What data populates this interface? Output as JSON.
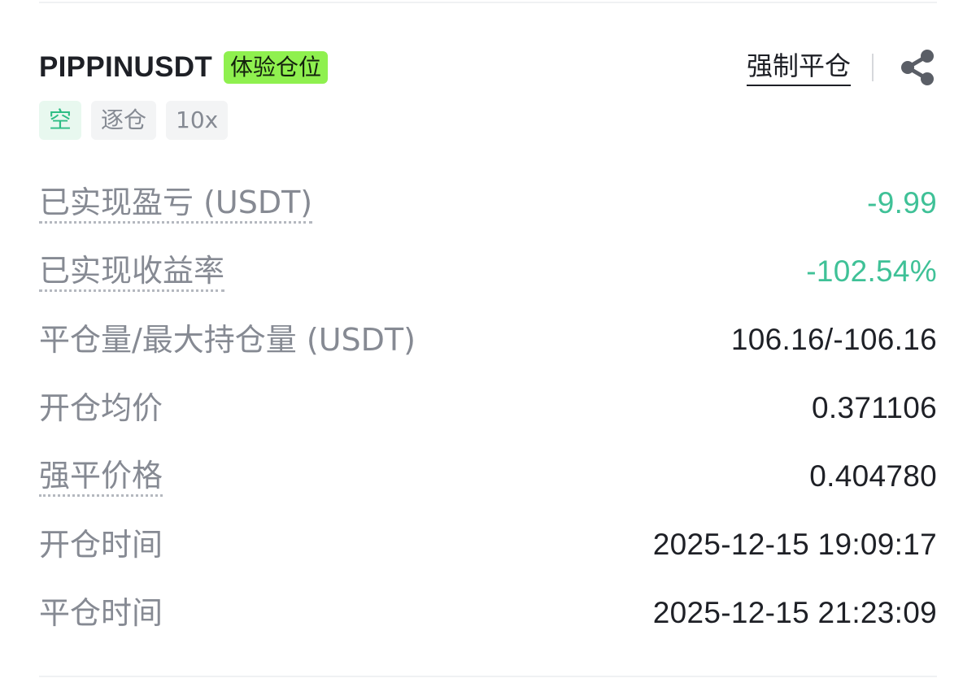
{
  "position": {
    "symbol": "PIPPINUSDT",
    "trial_badge": "体验仓位",
    "force_close_label": "强制平仓",
    "tags": {
      "side": "空",
      "margin_mode": "逐仓",
      "leverage": "10x"
    }
  },
  "details": {
    "realized_pnl": {
      "label": "已实现盈亏 (USDT)",
      "value": "-9.99"
    },
    "realized_roi": {
      "label": "已实现收益率",
      "value": "-102.54%"
    },
    "close_vs_max": {
      "label": "平仓量/最大持仓量 (USDT)",
      "value": "106.16/-106.16"
    },
    "avg_entry": {
      "label": "开仓均价",
      "value": "0.371106"
    },
    "liq_price": {
      "label": "强平价格",
      "value": "0.404780"
    },
    "open_time": {
      "label": "开仓时间",
      "value": "2025-12-15 19:09:17"
    },
    "close_time": {
      "label": "平仓时间",
      "value": "2025-12-15 21:23:09"
    }
  },
  "colors": {
    "profit_loss_green": "#3fc197",
    "trial_badge_bg": "#8ff04f",
    "side_tag_text": "#2ebd85"
  },
  "icons": {
    "share": "share-icon"
  }
}
